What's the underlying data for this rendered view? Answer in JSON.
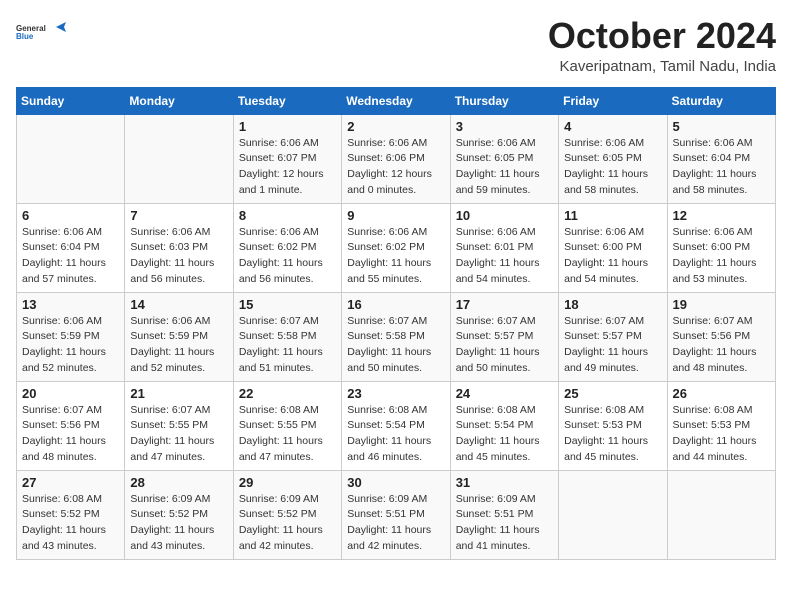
{
  "logo": {
    "text_general": "General",
    "text_blue": "Blue"
  },
  "title": {
    "month_year": "October 2024",
    "location": "Kaveripatnam, Tamil Nadu, India"
  },
  "headers": [
    "Sunday",
    "Monday",
    "Tuesday",
    "Wednesday",
    "Thursday",
    "Friday",
    "Saturday"
  ],
  "weeks": [
    [
      {
        "day": "",
        "sunrise": "",
        "sunset": "",
        "daylight": ""
      },
      {
        "day": "",
        "sunrise": "",
        "sunset": "",
        "daylight": ""
      },
      {
        "day": "1",
        "sunrise": "Sunrise: 6:06 AM",
        "sunset": "Sunset: 6:07 PM",
        "daylight": "Daylight: 12 hours and 1 minute."
      },
      {
        "day": "2",
        "sunrise": "Sunrise: 6:06 AM",
        "sunset": "Sunset: 6:06 PM",
        "daylight": "Daylight: 12 hours and 0 minutes."
      },
      {
        "day": "3",
        "sunrise": "Sunrise: 6:06 AM",
        "sunset": "Sunset: 6:05 PM",
        "daylight": "Daylight: 11 hours and 59 minutes."
      },
      {
        "day": "4",
        "sunrise": "Sunrise: 6:06 AM",
        "sunset": "Sunset: 6:05 PM",
        "daylight": "Daylight: 11 hours and 58 minutes."
      },
      {
        "day": "5",
        "sunrise": "Sunrise: 6:06 AM",
        "sunset": "Sunset: 6:04 PM",
        "daylight": "Daylight: 11 hours and 58 minutes."
      }
    ],
    [
      {
        "day": "6",
        "sunrise": "Sunrise: 6:06 AM",
        "sunset": "Sunset: 6:04 PM",
        "daylight": "Daylight: 11 hours and 57 minutes."
      },
      {
        "day": "7",
        "sunrise": "Sunrise: 6:06 AM",
        "sunset": "Sunset: 6:03 PM",
        "daylight": "Daylight: 11 hours and 56 minutes."
      },
      {
        "day": "8",
        "sunrise": "Sunrise: 6:06 AM",
        "sunset": "Sunset: 6:02 PM",
        "daylight": "Daylight: 11 hours and 56 minutes."
      },
      {
        "day": "9",
        "sunrise": "Sunrise: 6:06 AM",
        "sunset": "Sunset: 6:02 PM",
        "daylight": "Daylight: 11 hours and 55 minutes."
      },
      {
        "day": "10",
        "sunrise": "Sunrise: 6:06 AM",
        "sunset": "Sunset: 6:01 PM",
        "daylight": "Daylight: 11 hours and 54 minutes."
      },
      {
        "day": "11",
        "sunrise": "Sunrise: 6:06 AM",
        "sunset": "Sunset: 6:00 PM",
        "daylight": "Daylight: 11 hours and 54 minutes."
      },
      {
        "day": "12",
        "sunrise": "Sunrise: 6:06 AM",
        "sunset": "Sunset: 6:00 PM",
        "daylight": "Daylight: 11 hours and 53 minutes."
      }
    ],
    [
      {
        "day": "13",
        "sunrise": "Sunrise: 6:06 AM",
        "sunset": "Sunset: 5:59 PM",
        "daylight": "Daylight: 11 hours and 52 minutes."
      },
      {
        "day": "14",
        "sunrise": "Sunrise: 6:06 AM",
        "sunset": "Sunset: 5:59 PM",
        "daylight": "Daylight: 11 hours and 52 minutes."
      },
      {
        "day": "15",
        "sunrise": "Sunrise: 6:07 AM",
        "sunset": "Sunset: 5:58 PM",
        "daylight": "Daylight: 11 hours and 51 minutes."
      },
      {
        "day": "16",
        "sunrise": "Sunrise: 6:07 AM",
        "sunset": "Sunset: 5:58 PM",
        "daylight": "Daylight: 11 hours and 50 minutes."
      },
      {
        "day": "17",
        "sunrise": "Sunrise: 6:07 AM",
        "sunset": "Sunset: 5:57 PM",
        "daylight": "Daylight: 11 hours and 50 minutes."
      },
      {
        "day": "18",
        "sunrise": "Sunrise: 6:07 AM",
        "sunset": "Sunset: 5:57 PM",
        "daylight": "Daylight: 11 hours and 49 minutes."
      },
      {
        "day": "19",
        "sunrise": "Sunrise: 6:07 AM",
        "sunset": "Sunset: 5:56 PM",
        "daylight": "Daylight: 11 hours and 48 minutes."
      }
    ],
    [
      {
        "day": "20",
        "sunrise": "Sunrise: 6:07 AM",
        "sunset": "Sunset: 5:56 PM",
        "daylight": "Daylight: 11 hours and 48 minutes."
      },
      {
        "day": "21",
        "sunrise": "Sunrise: 6:07 AM",
        "sunset": "Sunset: 5:55 PM",
        "daylight": "Daylight: 11 hours and 47 minutes."
      },
      {
        "day": "22",
        "sunrise": "Sunrise: 6:08 AM",
        "sunset": "Sunset: 5:55 PM",
        "daylight": "Daylight: 11 hours and 47 minutes."
      },
      {
        "day": "23",
        "sunrise": "Sunrise: 6:08 AM",
        "sunset": "Sunset: 5:54 PM",
        "daylight": "Daylight: 11 hours and 46 minutes."
      },
      {
        "day": "24",
        "sunrise": "Sunrise: 6:08 AM",
        "sunset": "Sunset: 5:54 PM",
        "daylight": "Daylight: 11 hours and 45 minutes."
      },
      {
        "day": "25",
        "sunrise": "Sunrise: 6:08 AM",
        "sunset": "Sunset: 5:53 PM",
        "daylight": "Daylight: 11 hours and 45 minutes."
      },
      {
        "day": "26",
        "sunrise": "Sunrise: 6:08 AM",
        "sunset": "Sunset: 5:53 PM",
        "daylight": "Daylight: 11 hours and 44 minutes."
      }
    ],
    [
      {
        "day": "27",
        "sunrise": "Sunrise: 6:08 AM",
        "sunset": "Sunset: 5:52 PM",
        "daylight": "Daylight: 11 hours and 43 minutes."
      },
      {
        "day": "28",
        "sunrise": "Sunrise: 6:09 AM",
        "sunset": "Sunset: 5:52 PM",
        "daylight": "Daylight: 11 hours and 43 minutes."
      },
      {
        "day": "29",
        "sunrise": "Sunrise: 6:09 AM",
        "sunset": "Sunset: 5:52 PM",
        "daylight": "Daylight: 11 hours and 42 minutes."
      },
      {
        "day": "30",
        "sunrise": "Sunrise: 6:09 AM",
        "sunset": "Sunset: 5:51 PM",
        "daylight": "Daylight: 11 hours and 42 minutes."
      },
      {
        "day": "31",
        "sunrise": "Sunrise: 6:09 AM",
        "sunset": "Sunset: 5:51 PM",
        "daylight": "Daylight: 11 hours and 41 minutes."
      },
      {
        "day": "",
        "sunrise": "",
        "sunset": "",
        "daylight": ""
      },
      {
        "day": "",
        "sunrise": "",
        "sunset": "",
        "daylight": ""
      }
    ]
  ]
}
